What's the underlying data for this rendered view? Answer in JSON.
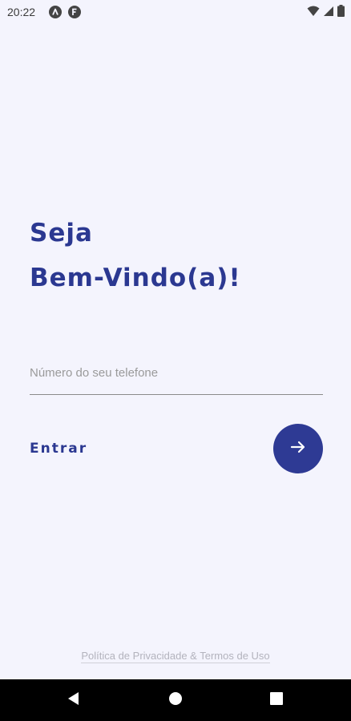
{
  "status_bar": {
    "time": "20:22",
    "icons": [
      "notification-a-icon",
      "notification-f-icon",
      "wifi-icon",
      "signal-icon",
      "battery-icon"
    ]
  },
  "welcome": {
    "line1": "Seja",
    "line2": "Bem-Vindo(a)!"
  },
  "phone": {
    "placeholder": "Número do seu telefone",
    "value": ""
  },
  "login": {
    "label": "Entrar",
    "submit_icon": "arrow-right-icon"
  },
  "footer": {
    "privacy_link": "Política de Privacidade & Termos de Uso"
  },
  "nav": {
    "icons": [
      "back-icon",
      "home-icon",
      "recents-icon"
    ]
  },
  "colors": {
    "background": "#f4f4fd",
    "accent": "#2b3891",
    "button": "#2e3a94"
  }
}
